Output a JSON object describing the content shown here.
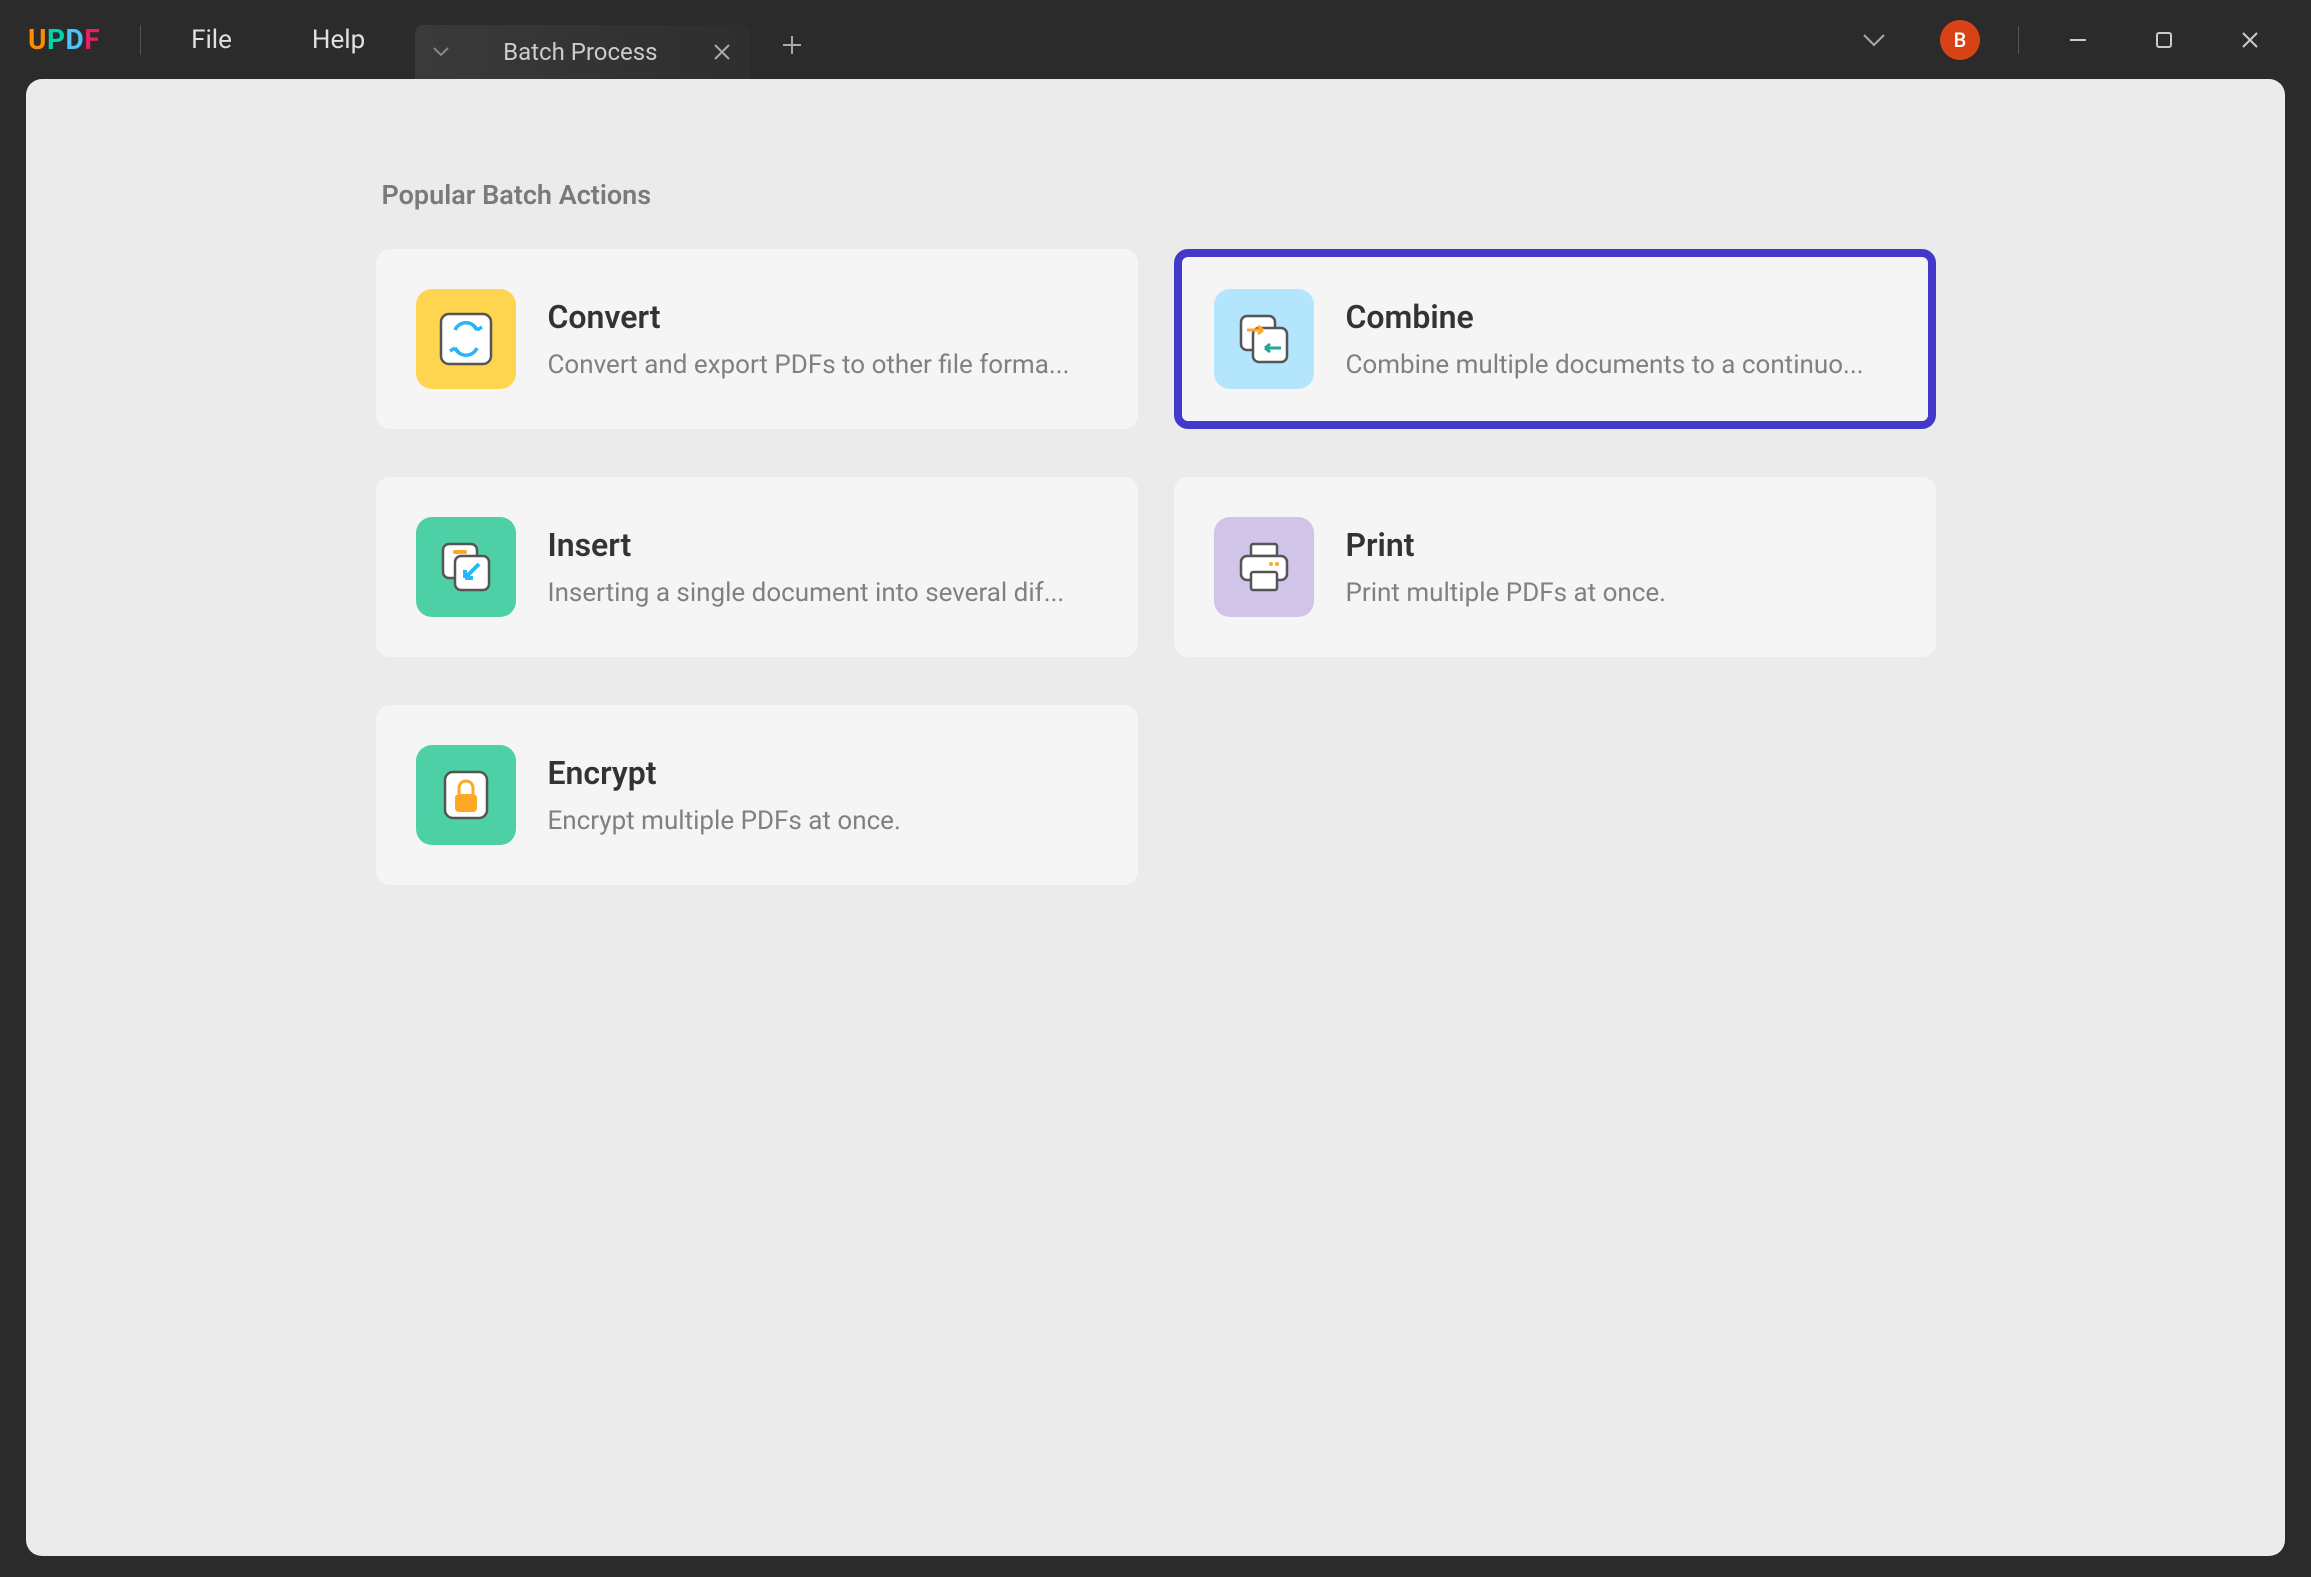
{
  "app": {
    "logo": {
      "u": "U",
      "p": "P",
      "d": "D",
      "f": "F"
    }
  },
  "menu": {
    "file": "File",
    "help": "Help"
  },
  "tab": {
    "title": "Batch Process"
  },
  "user": {
    "initial": "B"
  },
  "section_title": "Popular Batch Actions",
  "cards": {
    "convert": {
      "title": "Convert",
      "desc": "Convert and export PDFs to other file forma..."
    },
    "combine": {
      "title": "Combine",
      "desc": "Combine multiple documents to a continuo..."
    },
    "insert": {
      "title": "Insert",
      "desc": "Inserting a single document into several dif..."
    },
    "print": {
      "title": "Print",
      "desc": "Print multiple PDFs at once."
    },
    "encrypt": {
      "title": "Encrypt",
      "desc": "Encrypt multiple PDFs at once."
    }
  }
}
